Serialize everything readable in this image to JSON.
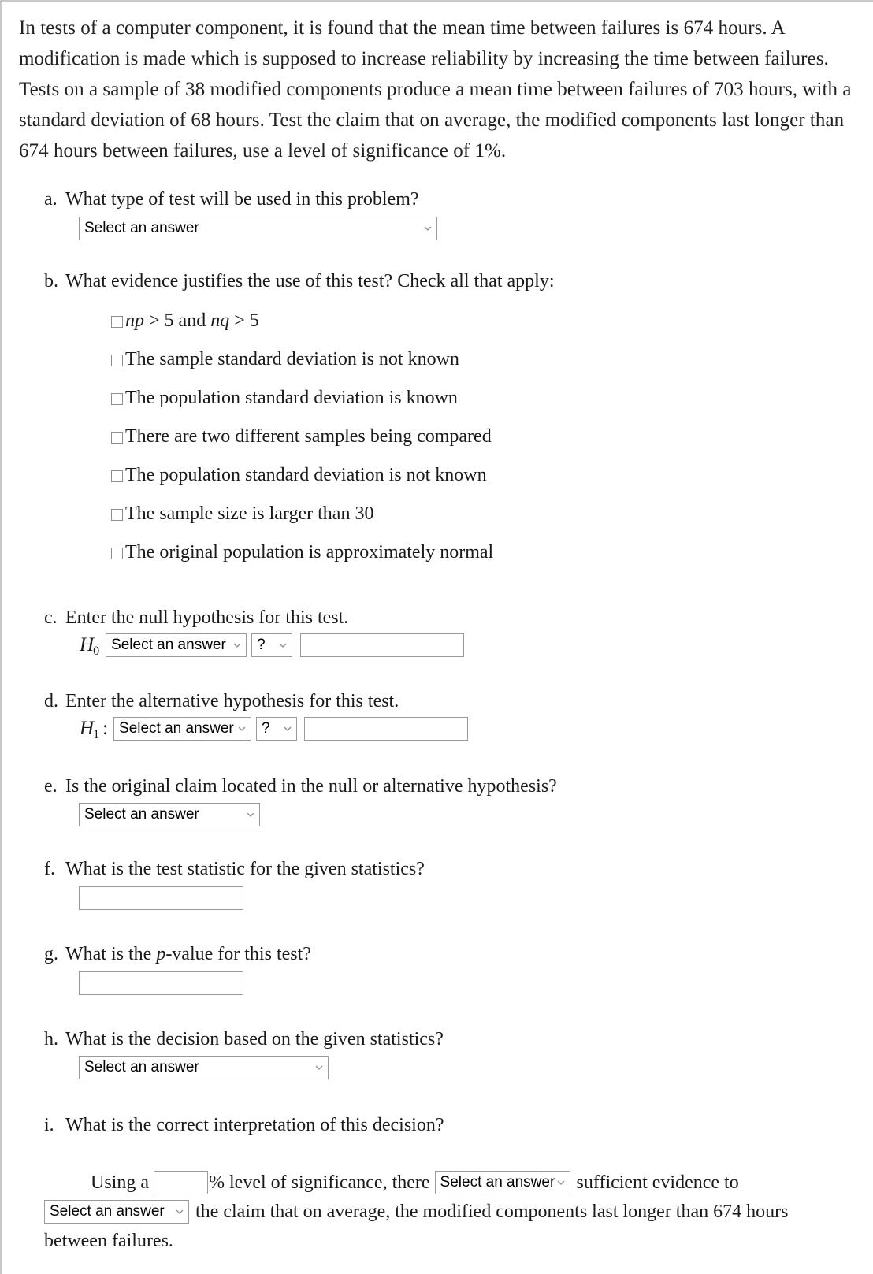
{
  "problem": {
    "statement": "In tests of a computer component, it is found that the mean time between failures is 674 hours. A modification is made which is supposed to increase reliability by increasing the time between failures. Tests on a sample of 38 modified components produce a mean time between failures of 703 hours, with a standard deviation of 68 hours. Test the claim that on average, the modified components last longer than 674 hours between failures, use a level of significance of 1%."
  },
  "common": {
    "select_placeholder": "Select an answer",
    "question_mark": "?",
    "chevron_icon": "chevron-down-icon"
  },
  "questions": {
    "a": {
      "label": "a.",
      "text": "What type of test will be used in this problem?",
      "select_value": "Select an answer"
    },
    "b": {
      "label": "b.",
      "text": "What evidence justifies the use of this test? Check all that apply:",
      "options": [
        {
          "math": true,
          "parts": [
            "np",
            " > 5 and ",
            "nq",
            " > 5"
          ]
        },
        {
          "math": false,
          "text": "The sample standard deviation is not known"
        },
        {
          "math": false,
          "text": "The population standard deviation is known"
        },
        {
          "math": false,
          "text": "There are two different samples being compared"
        },
        {
          "math": false,
          "text": "The population standard deviation is not known"
        },
        {
          "math": false,
          "text": "The sample size is larger than 30"
        },
        {
          "math": false,
          "text": "The original population is approximately normal"
        }
      ]
    },
    "c": {
      "label": "c.",
      "text": "Enter the null hypothesis for this test.",
      "hypothesis_symbol": "H",
      "hypothesis_subscript": "0",
      "hypothesis_suffix": "",
      "select_value": "Select an answer",
      "operator_value": "?",
      "input_value": ""
    },
    "d": {
      "label": "d.",
      "text": "Enter the alternative hypothesis for this test.",
      "hypothesis_symbol": "H",
      "hypothesis_subscript": "1",
      "hypothesis_suffix": ":",
      "select_value": "Select an answer",
      "operator_value": "?",
      "input_value": ""
    },
    "e": {
      "label": "e.",
      "text": "Is the original claim located in the null or alternative hypothesis?",
      "select_value": "Select an answer"
    },
    "f": {
      "label": "f.",
      "text": "What is the test statistic for the given statistics?",
      "input_value": ""
    },
    "g": {
      "label": "g.",
      "text_before": "What is the ",
      "text_italic": "p",
      "text_after": "-value for this test?",
      "input_value": ""
    },
    "h": {
      "label": "h.",
      "text": "What is the decision based on the given statistics?",
      "select_value": "Select an answer"
    },
    "i": {
      "label": "i.",
      "text": "What is the correct interpretation of this decision?",
      "sentence": {
        "part1": "Using a ",
        "alpha_input_value": "",
        "part2": "% level of significance, there ",
        "select1_value": "Select an answer",
        "part3": " sufficient evidence to",
        "select2_value": "Select an answer",
        "part4": " the claim that on average, the modified components last longer than 674 hours",
        "part5": "between failures."
      }
    }
  },
  "colors": {
    "text": "#1a1a1a",
    "control_border": "#9a9a9a",
    "page_border": "#c9c9c9",
    "chevron": "#8b8b8b"
  }
}
